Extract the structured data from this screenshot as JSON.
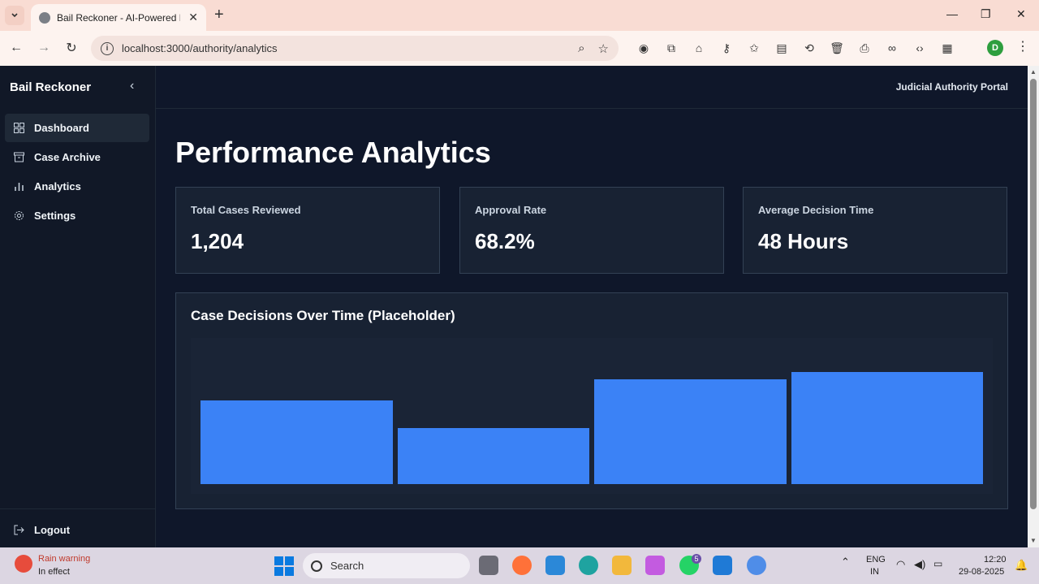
{
  "browser": {
    "tab_title": "Bail Reckoner - AI-Powered Bail",
    "url": "localhost:3000/authority/analytics",
    "profile_initial": "D"
  },
  "sidebar": {
    "brand": "Bail Reckoner",
    "items": [
      {
        "label": "Dashboard",
        "icon": "grid-icon"
      },
      {
        "label": "Case Archive",
        "icon": "archive-icon"
      },
      {
        "label": "Analytics",
        "icon": "bar-chart-icon"
      },
      {
        "label": "Settings",
        "icon": "gear-icon"
      }
    ],
    "logout": "Logout"
  },
  "header": {
    "portal": "Judicial Authority Portal"
  },
  "main": {
    "title": "Performance Analytics",
    "stats": [
      {
        "label": "Total Cases Reviewed",
        "value": "1,204"
      },
      {
        "label": "Approval Rate",
        "value": "68.2%"
      },
      {
        "label": "Average Decision Time",
        "value": "48 Hours"
      }
    ],
    "chart_title": "Case Decisions Over Time (Placeholder)"
  },
  "chart_data": {
    "type": "bar",
    "title": "Case Decisions Over Time (Placeholder)",
    "categories": [
      "",
      "",
      "",
      ""
    ],
    "values": [
      60,
      40,
      75,
      80
    ],
    "ylim": [
      0,
      100
    ],
    "grid": false,
    "color": "#3b82f6"
  },
  "taskbar": {
    "weather_title": "Rain warning",
    "weather_sub": "In effect",
    "search": "Search",
    "lang1": "ENG",
    "lang2": "IN",
    "time": "12:20",
    "date": "29-08-2025",
    "whatsapp_badge": "5"
  },
  "colors": {
    "accent": "#3b82f6",
    "background": "#0f172a",
    "sidebar": "#111827"
  }
}
